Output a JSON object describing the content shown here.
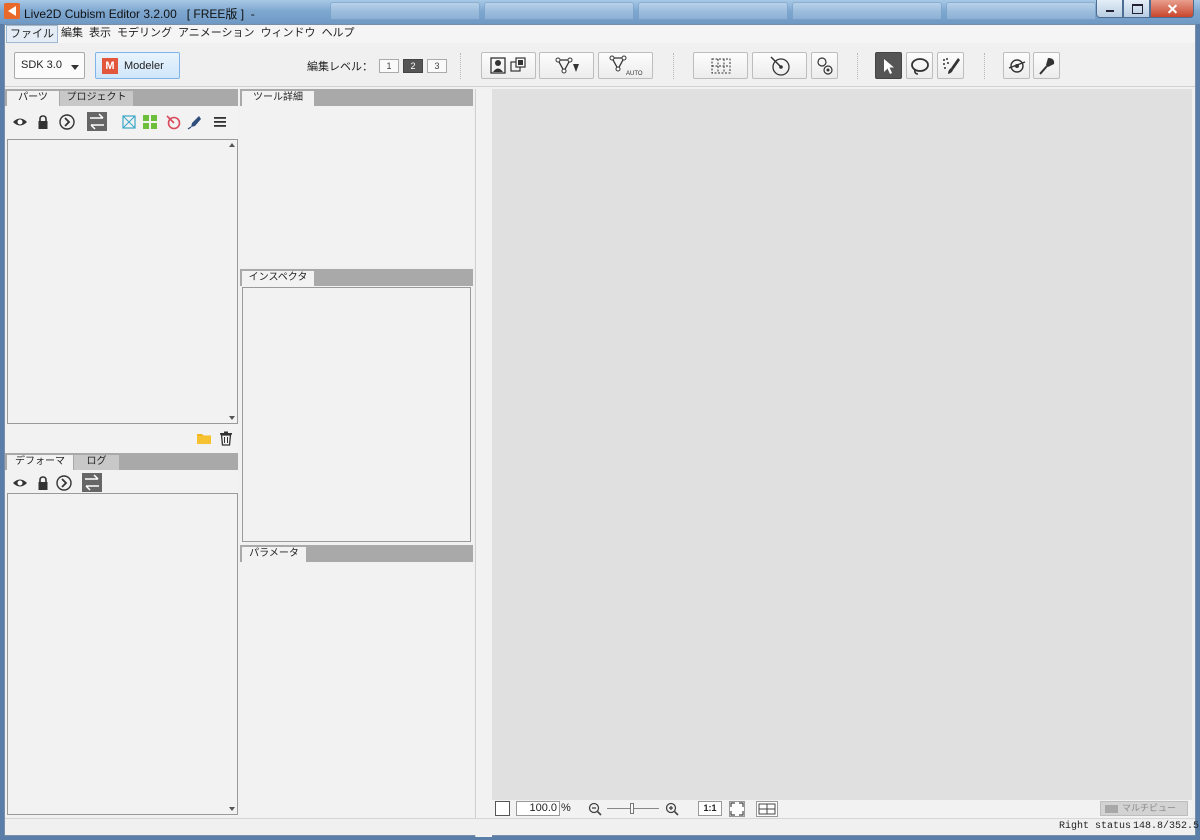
{
  "window": {
    "title": "Live2D Cubism Editor 3.2.00   [ FREE版 ]  -"
  },
  "menu": {
    "items": [
      "ファイル",
      "編集",
      "表示",
      "モデリング",
      "アニメーション",
      "ウィンドウ",
      "ヘルプ"
    ]
  },
  "toolbar": {
    "sdk_value": "SDK 3.0",
    "modeler_label": "Modeler",
    "modeler_icon_letter": "M",
    "edit_level_label": "編集レベル：",
    "edit_levels": [
      "1",
      "2",
      "3"
    ],
    "edit_level_selected": "2",
    "auto_label": "AUTO"
  },
  "parts_panel": {
    "tabs": [
      "パーツ",
      "プロジェクト"
    ]
  },
  "deformer_panel": {
    "tabs": [
      "デフォーマ",
      "ログ"
    ]
  },
  "tool_detail_panel": {
    "tab": "ツール詳細"
  },
  "inspector_panel": {
    "tab": "インスペクタ"
  },
  "parameter_panel": {
    "tab": "パラメータ"
  },
  "viewport": {
    "zoom_value": "100.0",
    "zoom_unit": "%",
    "zoom_ratio_label": "1:1",
    "multiview_label": "マルチビュー"
  },
  "status": {
    "right_status": "Right status",
    "coords": "148.8/352.5"
  },
  "colors": {
    "accent": "#e8692a",
    "modeler_bg": "#cfe6fa",
    "canvas": "#e0e0e0"
  }
}
